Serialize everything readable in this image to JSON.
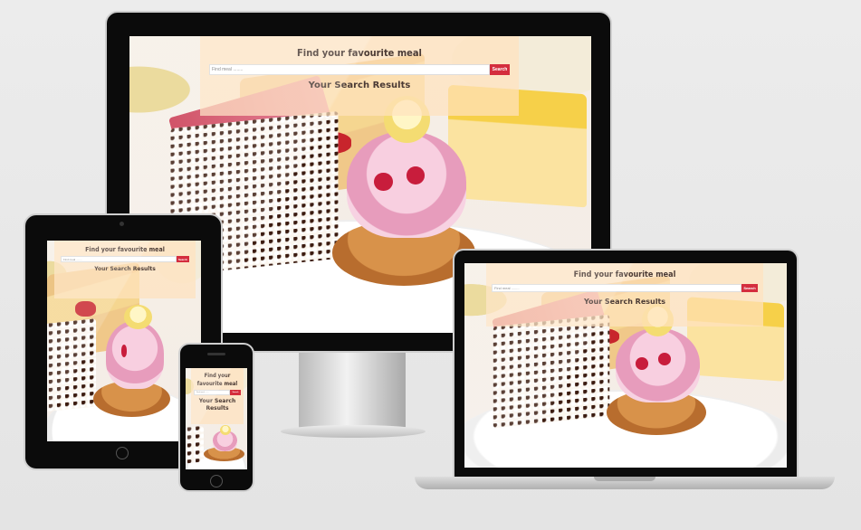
{
  "page": {
    "title": "Find your favourite meal",
    "search": {
      "placeholder": "Find meal ........",
      "button_label": "Search"
    },
    "results_heading": "Your Search Results"
  },
  "devices": [
    "desktop-monitor",
    "tablet",
    "laptop",
    "phone"
  ],
  "colors": {
    "overlay": "#ffe2be",
    "button": "#d42d3e",
    "bezel": "#0b0b0b",
    "background": "#ececec"
  }
}
